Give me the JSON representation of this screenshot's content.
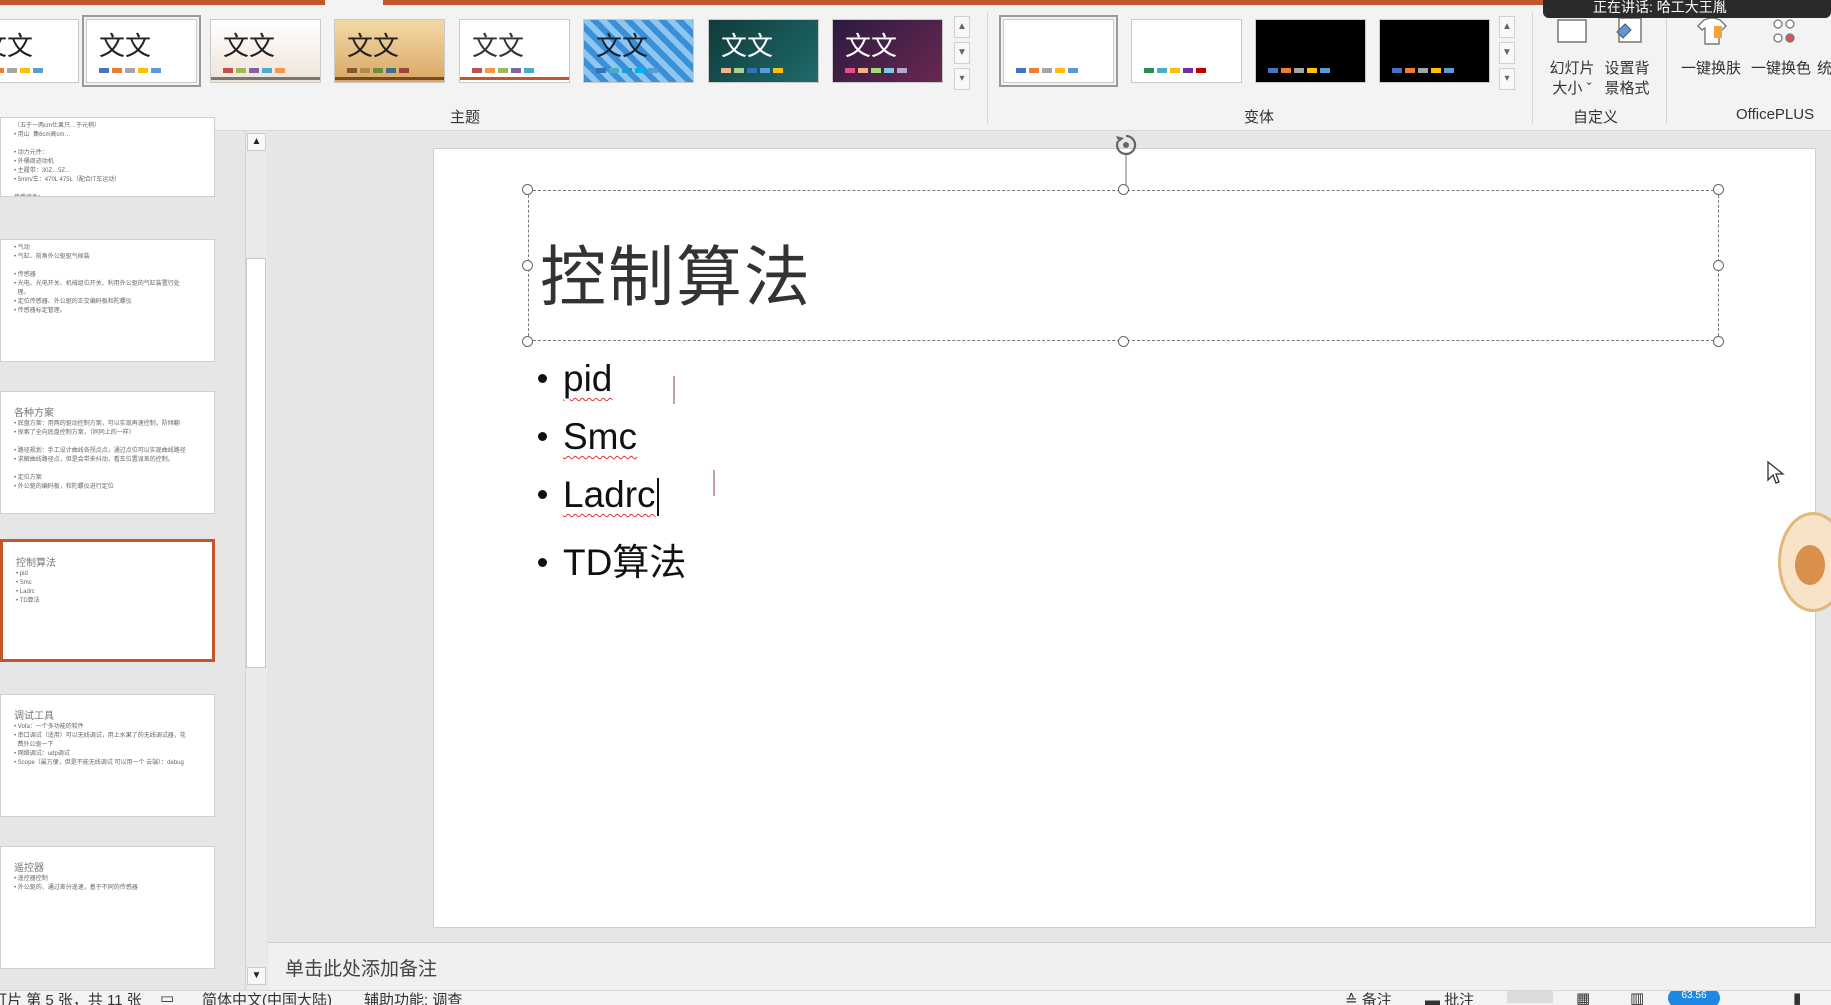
{
  "ribbon": {
    "themes": [
      {
        "label": "文文",
        "colors": [
          "#4472c4",
          "#ed7d31",
          "#a5a5a5",
          "#ffc000",
          "#5b9bd5"
        ]
      },
      {
        "label": "文文",
        "colors": [
          "#4472c4",
          "#ed7d31",
          "#a5a5a5",
          "#ffc000",
          "#5b9bd5"
        ]
      },
      {
        "label": "文文",
        "colors": [
          "#c0504d",
          "#9bbb59",
          "#8064a2",
          "#4bacc6",
          "#f79646"
        ]
      },
      {
        "label": "文文",
        "colors": [
          "#7b5a2e",
          "#b08a4e",
          "#6d8b3c",
          "#3d6f8f",
          "#a04040"
        ]
      },
      {
        "label": "文文",
        "colors": [
          "#c0504d",
          "#f79646",
          "#9bbb59",
          "#8064a2",
          "#4bacc6"
        ]
      },
      {
        "label": "文文",
        "colors": [
          "#2e75b6",
          "#4bacc6",
          "#1f9ad6",
          "#00b0f0",
          "#5b9bd5"
        ]
      },
      {
        "label": "文文",
        "colors": [
          "#f4b183",
          "#a9d18e",
          "#2e75b6",
          "#5b9bd5",
          "#ffc000"
        ]
      },
      {
        "label": "文文",
        "colors": [
          "#e84c8b",
          "#f4b183",
          "#a3d977",
          "#7ec8e3",
          "#b4a7d6"
        ]
      }
    ],
    "variants": [
      {
        "colors": [
          "#4472c4",
          "#ed7d31",
          "#a5a5a5",
          "#ffc000",
          "#5b9bd5"
        ]
      },
      {
        "colors": [
          "#2e8b57",
          "#4bacc6",
          "#ffc000",
          "#7030a0",
          "#c00000"
        ]
      },
      {
        "colors": [
          "#4472c4",
          "#ed7d31",
          "#a5a5a5",
          "#ffc000",
          "#5b9bd5"
        ]
      },
      {
        "colors": [
          "#4472c4",
          "#ed7d31",
          "#a5a5a5",
          "#ffc000",
          "#5b9bd5"
        ]
      }
    ],
    "groups": {
      "themes_label": "主题",
      "variants_label": "变体",
      "custom_label": "自定义",
      "officeplus_label": "OfficePLUS"
    },
    "custom": {
      "slide_size_line1": "幻灯片",
      "slide_size_line2": "大小 ˇ",
      "bg_format_line1": "设置背",
      "bg_format_line2": "景格式"
    },
    "officeplus": {
      "one_click_skin": "一键换肤",
      "one_click_color": "一键换色",
      "truncated": "统"
    }
  },
  "slides": [
    {
      "title": "",
      "body": "（五于一两cm仕果只…于元稍）\n• 用山  集6cm高cm…\n\n• 动力元件：\n• 外桶周迹动机\n• 主履带：30Z…5Z…\n• 5mm/车：470L 475L（配合IT车运动）\n\n传感组件：\n电池触底支件、金线组件"
    },
    {
      "title": "",
      "body": "• 气动\n• 气缸、前角外公驱驱气候装\n\n• 传感器\n• 光电、光电开关、机械组位开关、利用外公驱的气缸装置行处\n  理。\n• 定位传感器、外公驱的正交编码板和陀螺仪\n• 传感器标定管理。"
    },
    {
      "title": "各种方案",
      "body": "• 底盘方案：用两的驱动控制方案，可以实现再速控制，防倾翻\n• 探索了全向底盘控制方案，（同同上的一样）\n\n• 路径规划：手工设计曲线各拐点点，通过点位可以实现曲线路径\n• 求解曲线路径点，但是会带来抖动，看车位置误差的控制。\n\n• 定位方案\n• 外公驱的编码板，和陀螺仪进行定位"
    },
    {
      "title": "控制算法",
      "body": "• pid\n• Smc\n• Ladrc\n• TD算法"
    },
    {
      "title": "调试工具",
      "body": "• Vofa：一个多功能的软件\n• 串口调试（适用）可以无线调试，用上水果了的无线调试器，花\n  费外公驱一下\n• 网络调试：udp调试\n• Scope（最方便，但是不能无线调试 可以用一个 云端）：debug"
    },
    {
      "title": "遥控器",
      "body": "• 遥控器控制\n• 外公驱的、通过差分遥速，基于不同的传感器"
    }
  ],
  "current_slide": {
    "title": "控制算法",
    "bullets": [
      "pid",
      "Smc",
      "Ladrc",
      "TD算法"
    ]
  },
  "notes_placeholder": "单击此处添加备注",
  "statusbar": {
    "slide_info": "灯片 第 5 张，共 11 张",
    "language": "简体中文(中国大陆)",
    "accessibility": "辅助功能: 调查",
    "notes_btn": "≙ 备注",
    "comments_btn": "批注",
    "zoom_badge": "63.56"
  },
  "overlay_text": "正在讲话: 哈工大王胤"
}
